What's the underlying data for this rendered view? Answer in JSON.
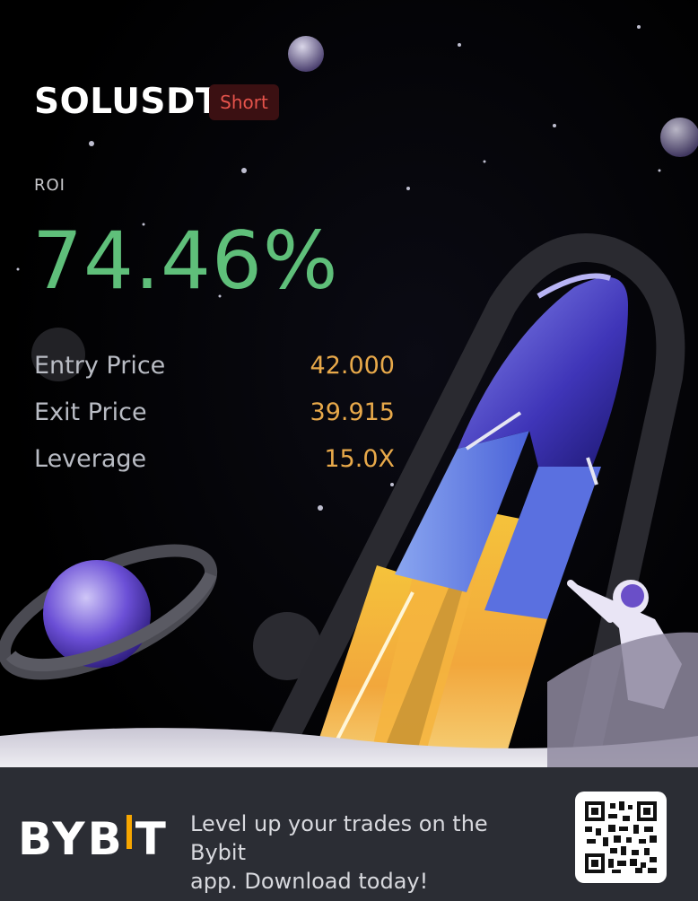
{
  "trade": {
    "symbol": "SOLUSDT",
    "side": "Short",
    "roi_label": "ROI",
    "roi_value": "74.46%"
  },
  "stats": [
    {
      "label": "Entry Price",
      "value": "42.000"
    },
    {
      "label": "Exit Price",
      "value": "39.915"
    },
    {
      "label": "Leverage",
      "value": "15.0X"
    }
  ],
  "footer": {
    "brand_left": "BYB",
    "brand_right": "T",
    "promo_line1": "Level up your trades on the Bybit",
    "promo_line2": "app. Download today!"
  },
  "colors": {
    "background": "#000000",
    "roi": "#5fbf7a",
    "side_short": "#e5534b",
    "stat_value": "#e8a94a",
    "footer": "#2b2d34",
    "brand_accent": "#f7a600"
  },
  "icons": {
    "illustration": "rocket-astronaut-planet-illustration",
    "qr": "qr-code-icon"
  }
}
